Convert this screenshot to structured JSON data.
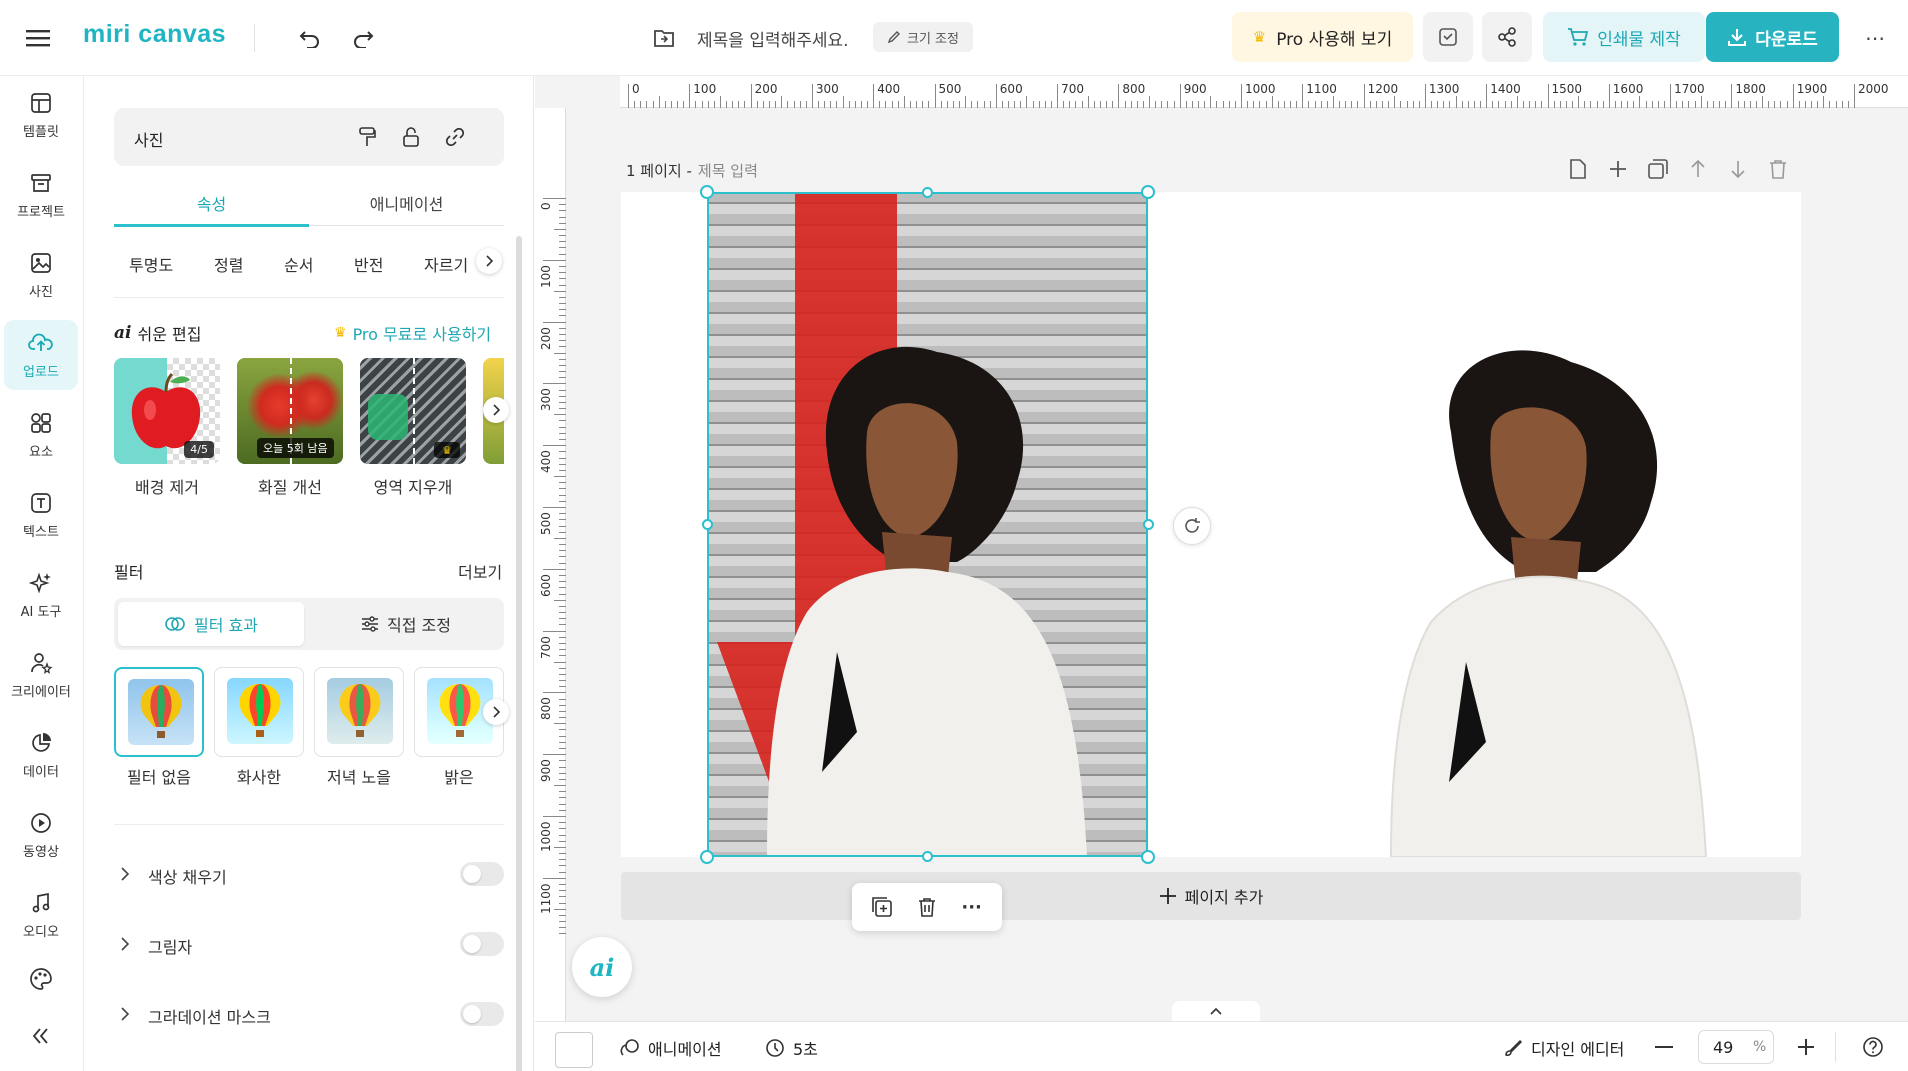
{
  "app": {
    "logo": "miri canvas"
  },
  "header": {
    "doc_title_placeholder": "제목을 입력해주세요.",
    "resize_label": "크기 조정",
    "pro_label": "Pro 사용해 보기",
    "print_label": "인쇄물 제작",
    "download_label": "다운로드"
  },
  "rail": [
    {
      "label": "템플릿",
      "icon": "template-icon"
    },
    {
      "label": "프로젝트",
      "icon": "project-icon"
    },
    {
      "label": "사진",
      "icon": "photo-icon"
    },
    {
      "label": "업로드",
      "icon": "upload-icon"
    },
    {
      "label": "요소",
      "icon": "elements-icon"
    },
    {
      "label": "텍스트",
      "icon": "text-icon"
    },
    {
      "label": "AI 도구",
      "icon": "ai-tools-icon"
    },
    {
      "label": "크리에이터",
      "icon": "creator-icon"
    },
    {
      "label": "데이터",
      "icon": "data-icon"
    },
    {
      "label": "동영상",
      "icon": "video-icon"
    },
    {
      "label": "오디오",
      "icon": "audio-icon"
    }
  ],
  "panel": {
    "header_title": "사진",
    "tabs": [
      "속성",
      "애니메이션"
    ],
    "subtabs": [
      "투명도",
      "정렬",
      "순서",
      "반전",
      "자르기"
    ],
    "easy_edit": {
      "title": "쉬운 편집",
      "pro_link": "Pro 무료로 사용하기",
      "items": [
        {
          "label": "배경 제거",
          "badge": "4/5"
        },
        {
          "label": "화질 개선",
          "badge": "오늘 5회 남음"
        },
        {
          "label": "영역 지우개",
          "badge": ""
        }
      ]
    },
    "filter": {
      "title": "필터",
      "more": "더보기",
      "seg": [
        "필터 효과",
        "직접 조정"
      ],
      "items": [
        "필터 없음",
        "화사한",
        "저녁 노을",
        "밝은"
      ]
    },
    "toggles": [
      "색상 채우기",
      "그림자",
      "그라데이션 마스크"
    ]
  },
  "canvas": {
    "page_label": "1 페이지 -",
    "page_title_placeholder": "제목 입력",
    "add_page": "페이지 추가",
    "ruler_h": [
      "0",
      "100",
      "200",
      "300",
      "400",
      "500",
      "600",
      "700",
      "800",
      "900",
      "1000",
      "1100",
      "1200",
      "1300",
      "1400",
      "1500",
      "1600",
      "1700",
      "1800",
      "1900",
      "2000"
    ],
    "ruler_v": [
      "0",
      "100",
      "200",
      "300",
      "400",
      "500",
      "600",
      "700",
      "800",
      "900",
      "1000",
      "1100"
    ]
  },
  "bottom": {
    "animation": "애니메이션",
    "duration": "5초",
    "design_editor": "디자인 에디터",
    "zoom": "49",
    "zoom_unit": "%"
  },
  "colors": {
    "accent": "#2cc0cd",
    "download_bg": "#27b3c0",
    "print_bg": "#e3f5f7",
    "pro_bg": "#fff7e1"
  }
}
